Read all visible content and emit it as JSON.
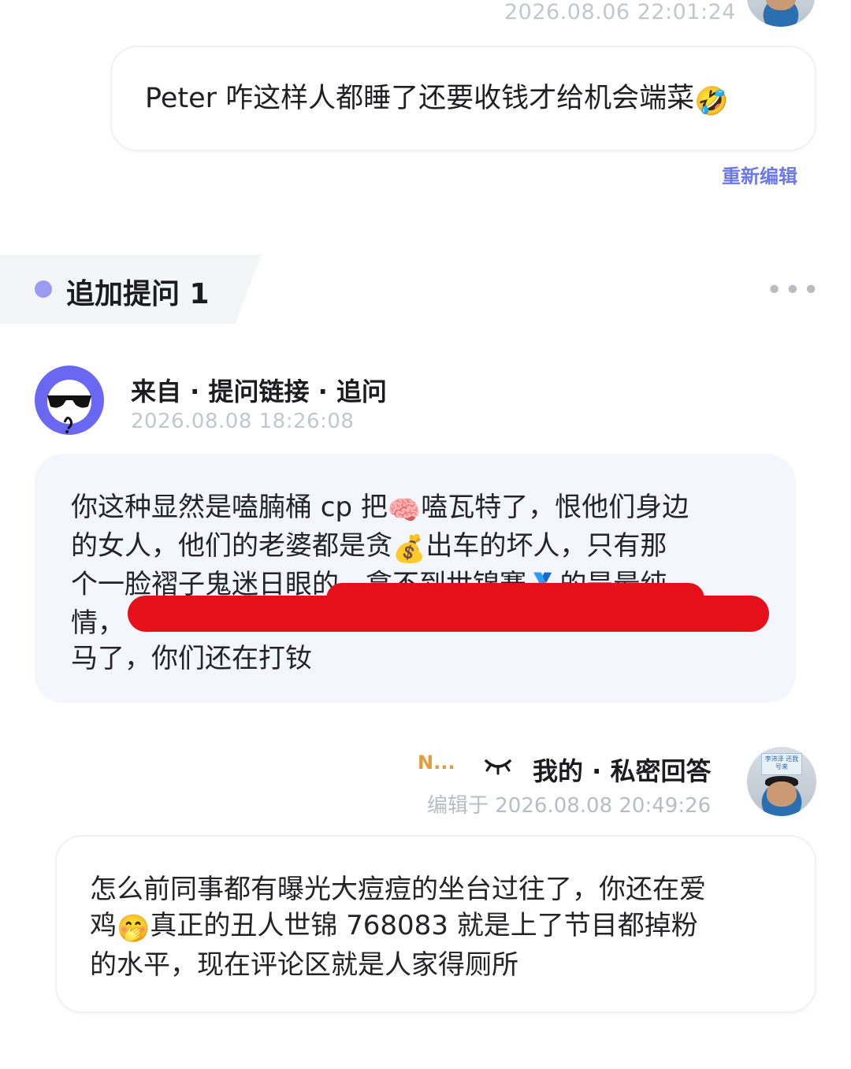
{
  "top_message": {
    "timestamp": "2026.08.06 22:01:24",
    "text": "Peter 咋这样人都睡了还要收钱才给机会端菜",
    "emoji": "🤣",
    "re_edit_label": "重新编辑"
  },
  "section": {
    "title": "追加提问 1",
    "more_label": "•••"
  },
  "follow_up": {
    "source_label": "来自 · 提问链接 · 追问",
    "timestamp": "2026.08.08 18:26:08",
    "lines": [
      {
        "a": "你这种显然是嗑腩桶 cp 把",
        "emoji": "🧠",
        "b": "嗑瓦特了，恨他们身边"
      },
      {
        "a": "的女人，他们的老婆都是贪",
        "emoji": "💰",
        "b": "出车的坏人，只有那"
      },
      {
        "a": "个一脸褶子鬼迷日眼的，拿不到世锦赛",
        "emoji": "🥇",
        "b": "的是最纯"
      },
      {
        "a": "情，",
        "emoji": "",
        "b": ""
      },
      {
        "a": "马了，你们还在打钕",
        "emoji": "",
        "b": ""
      }
    ]
  },
  "answer": {
    "nickname": "N...",
    "eye_icon": "closed-eye-icon",
    "label": "我的 · 私密回答",
    "timestamp": "编辑于 2026.08.08 20:49:26",
    "avatar_sign_text": "李沛泽 还我号来",
    "lines": [
      {
        "a": "怎么前同事都有曝光大痘痘的坐台过往了，你还在爱",
        "emoji": "",
        "b": ""
      },
      {
        "a": "鸡",
        "emoji": "🤭",
        "b": "真正的丑人世锦 768083 就是上了节目都掉粉"
      },
      {
        "a": "的水平，现在评论区就是人家得厕所",
        "emoji": "",
        "b": ""
      }
    ]
  },
  "colors": {
    "accent_purple": "#6b78e8",
    "avatar_purple": "#6a67f2",
    "redaction_red": "#e6101a",
    "nickname_orange": "#e59a3c"
  }
}
